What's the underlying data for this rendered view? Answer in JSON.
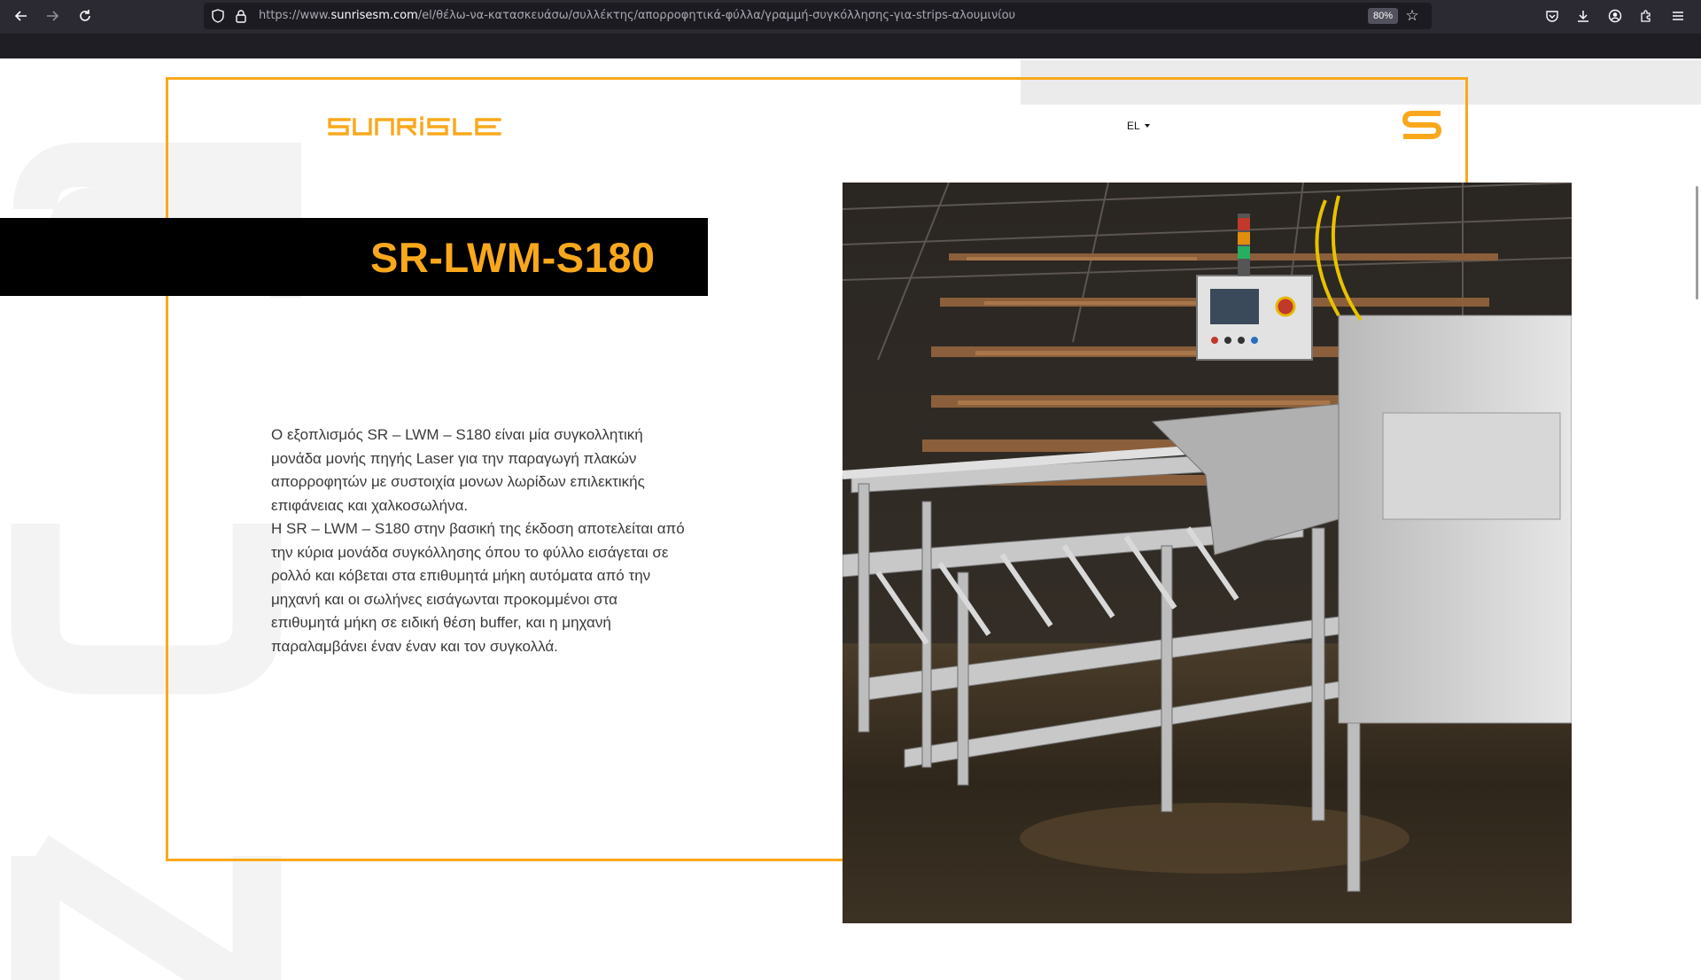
{
  "browser": {
    "url_prefix": "https://www.",
    "url_host": "sunrisesm.com",
    "url_path": "/el/θέλω-να-κατασκευάσω/συλλέκτης/απορροφητικά-φύλλα/γραμμή-συγκόλλησης-για-strips-αλουμινίου",
    "zoom": "80%",
    "icons": [
      "back-arrow-icon",
      "forward-arrow-icon",
      "reload-icon",
      "shield-icon",
      "lock-icon",
      "bookmark-star-icon",
      "pocket-icon",
      "download-icon",
      "account-icon",
      "extensions-icon",
      "menu-icon"
    ]
  },
  "header": {
    "logo_text": "SUNRISE",
    "language": "EL"
  },
  "product": {
    "title": "SR-LWM-S180",
    "description_1": "Ο εξοπλισμός SR – LWM – S180 είναι μία συγκολλητική μονάδα μονής πηγής Laser για την παραγωγή πλακών απορροφητών με συστοιχία μονων λωρίδων επιλεκτικής επιφάνειας και χαλκοσωλήνα.",
    "description_2": "Η SR – LWM – S180 στην βασική της έκδοση αποτελείται από την κύρια μονάδα συγκόλλησης όπου το φύλλο εισάγεται σε ρολλό και κόβεται στα επιθυμητά μήκη αυτόματα από την μηχανή και οι σωλήνες εισάγωνται προκομμένοι στα επιθυμητά μήκη σε ειδική θέση buffer, και η μηχανή παραλαμβάνει έναν έναν και τον συγκολλά."
  },
  "colors": {
    "accent": "#f9a81c",
    "title_bar": "#000000",
    "chrome_bg": "#2b2a33",
    "urlbar_bg": "#1c1b22"
  }
}
